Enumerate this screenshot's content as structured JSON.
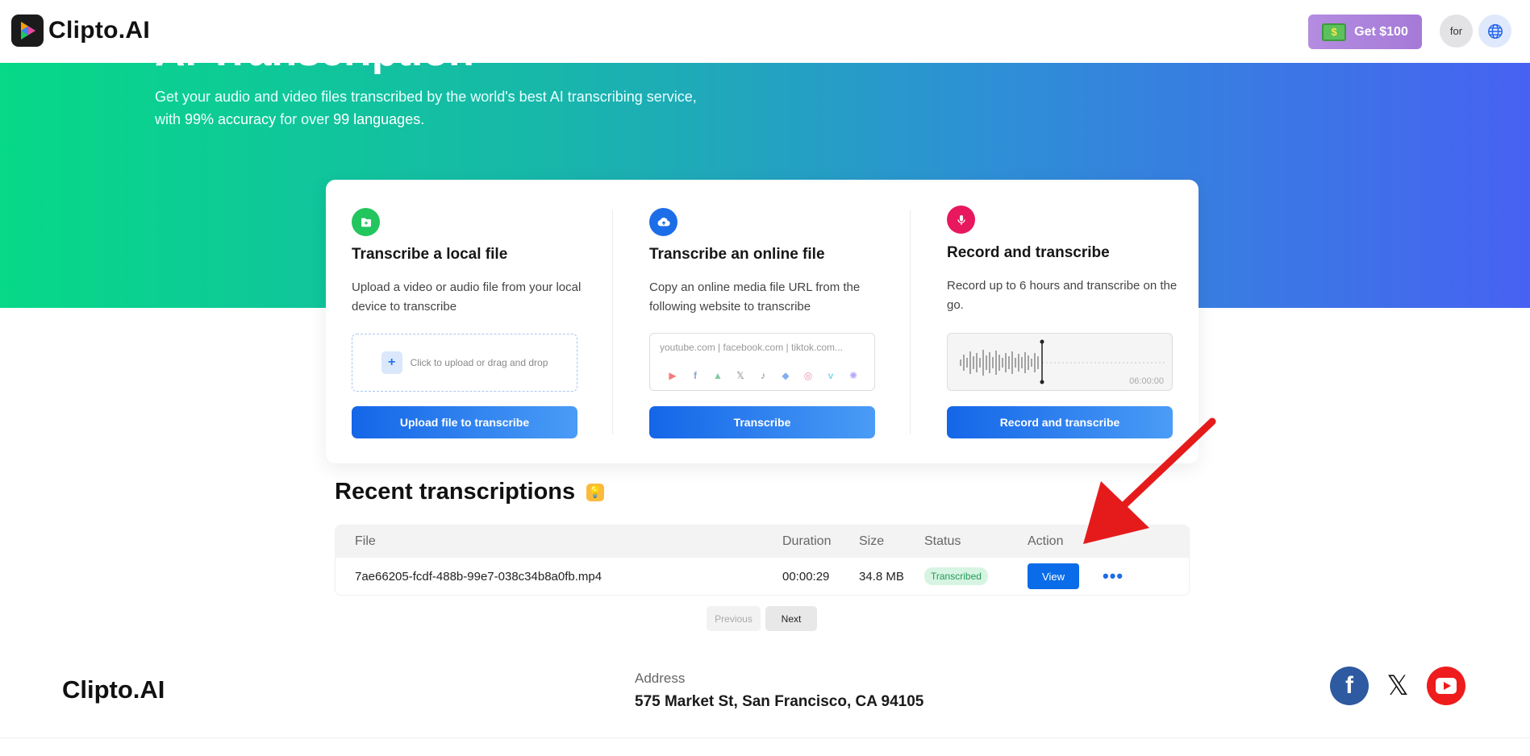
{
  "header": {
    "logo_text": "Clipto.AI",
    "promo_label": "Get $100",
    "promo_icon": "money-icon",
    "avatar_text": "for",
    "language_icon": "globe-icon"
  },
  "hero": {
    "title": "AI Transcription",
    "subtitle_line1": "Get your audio and video files transcribed by the world's best AI transcribing service,",
    "subtitle_with": "with ",
    "subtitle_accuracy": "99% accuracy",
    "subtitle_for": " for over ",
    "subtitle_languages": "99 languages",
    "subtitle_end": "."
  },
  "options": [
    {
      "title": "Transcribe a local file",
      "description": "Upload a video or audio file from your local device to transcribe",
      "dropzone_text": "Click to upload or drag and drop",
      "button": "Upload file to transcribe",
      "icon": "folder-plus-icon",
      "color": "#22c55e"
    },
    {
      "title": "Transcribe an online file",
      "description": "Copy an online media file URL from the following website to transcribe",
      "url_placeholder": "youtube.com | facebook.com | tiktok.com...",
      "button": "Transcribe",
      "icon": "cloud-upload-icon",
      "color": "#1c6ee8"
    },
    {
      "title": "Record and transcribe",
      "description": "Record up to 6 hours and transcribe on the go.",
      "record_time": "06:00:00",
      "button": "Record and transcribe",
      "icon": "microphone-icon",
      "color": "#e8185e"
    }
  ],
  "recent": {
    "title": "Recent transcriptions",
    "columns": [
      "File",
      "Duration",
      "Size",
      "Status",
      "Action"
    ],
    "rows": [
      {
        "file": "7ae66205-fcdf-488b-99e7-038c34b8a0fb.mp4",
        "duration": "00:00:29",
        "size": "34.8 MB",
        "status": "Transcribed",
        "action": "View"
      }
    ],
    "prev_label": "Previous",
    "next_label": "Next"
  },
  "footer": {
    "logo_text": "Clipto.AI",
    "address_label": "Address",
    "address": "575 Market St, San Francisco, CA 94105"
  },
  "colors": {
    "primary": "#0a6ce8",
    "hero_start": "#06d987",
    "hero_end": "#4762f2",
    "annotation_arrow": "#e51b1b"
  }
}
